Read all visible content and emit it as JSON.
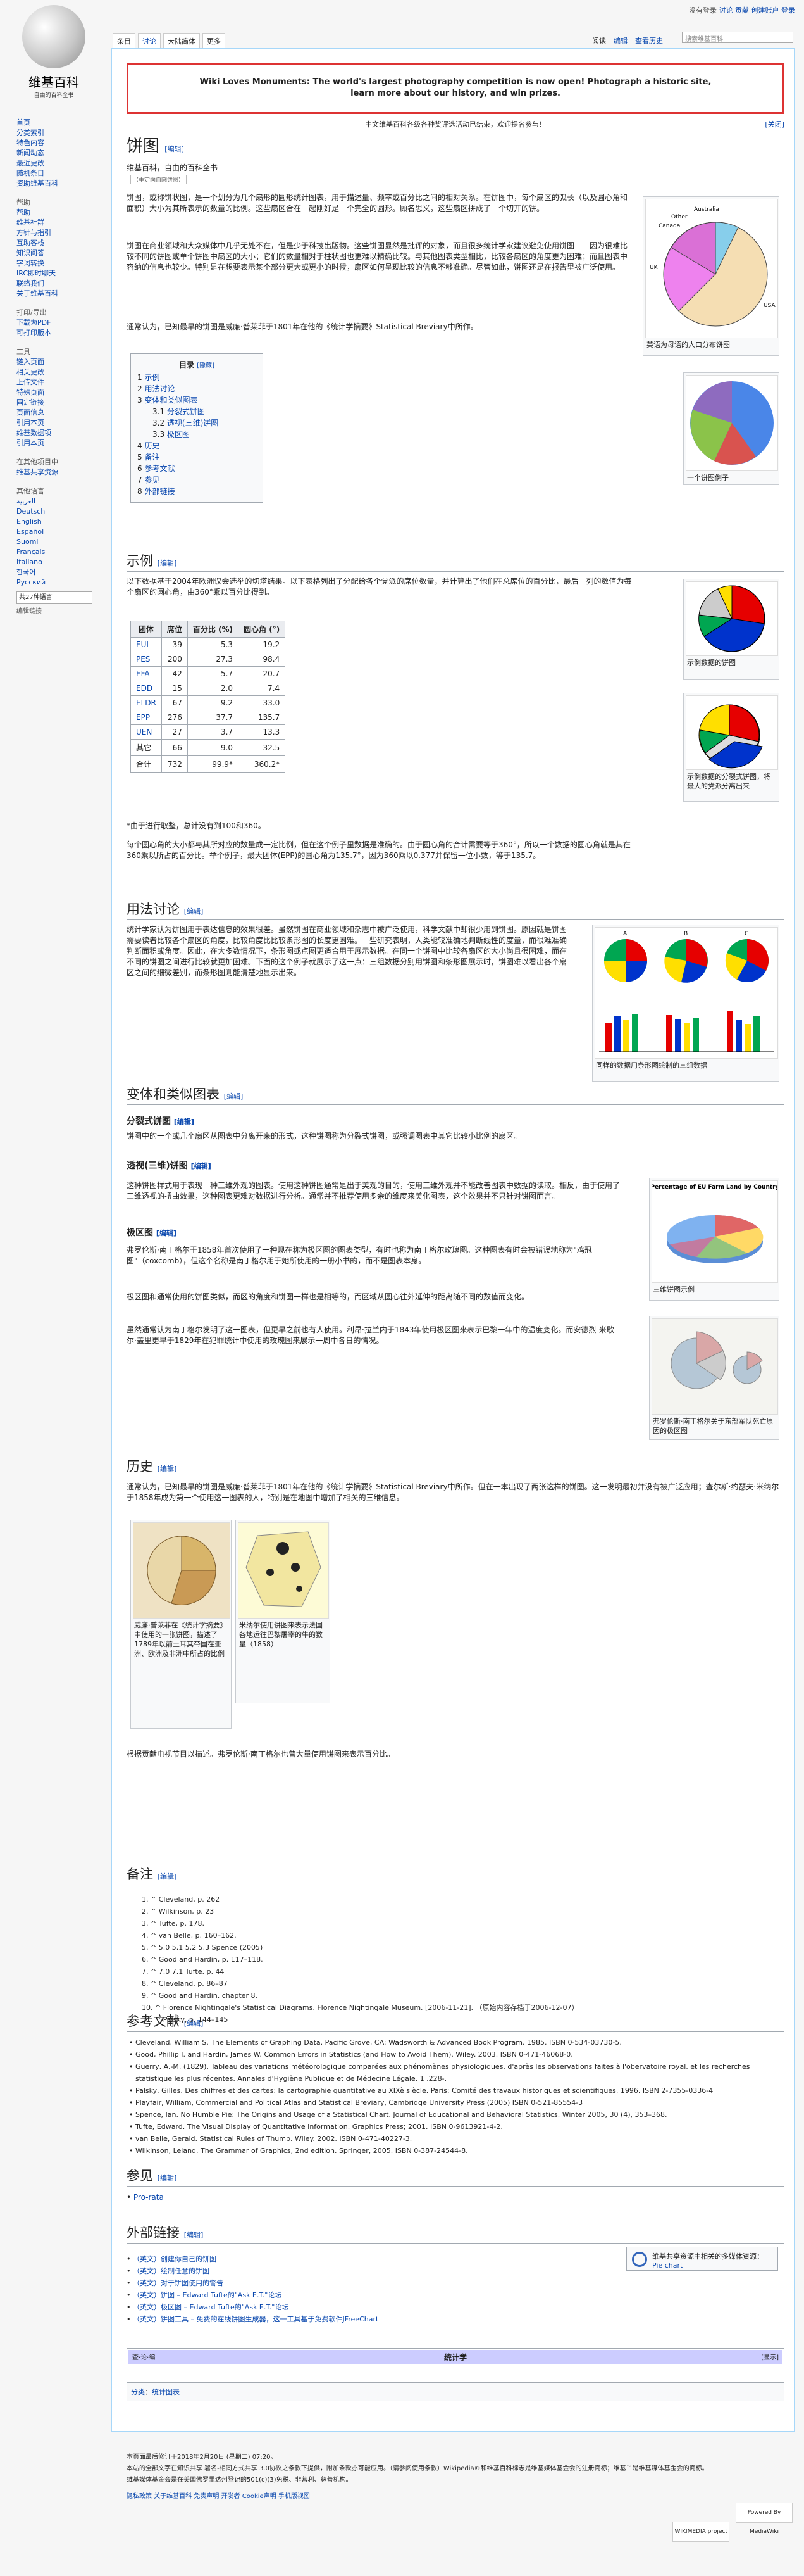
{
  "logo": {
    "name": "维基百科",
    "tagline": "自由的百科全书"
  },
  "personal_tools": [
    "没有登录",
    "讨论",
    "贡献",
    "创建账户",
    "登录"
  ],
  "tabs_left": [
    "条目",
    "讨论",
    "大陆简体",
    "更多"
  ],
  "tabs_right": [
    "阅读",
    "编辑",
    "查看历史"
  ],
  "search_placeholder": "搜索维基百科",
  "sidebar": {
    "nav": [
      "首页",
      "分类索引",
      "特色内容",
      "新闻动态",
      "最近更改",
      "随机条目",
      "资助维基百科"
    ],
    "help_title": "帮助",
    "help": [
      "帮助",
      "维基社群",
      "方针与指引",
      "互助客栈",
      "知识问答",
      "字词转换",
      "IRC即时聊天",
      "联络我们",
      "关于维基百科"
    ],
    "tools_title": "工具",
    "tools": [
      "链入页面",
      "相关更改",
      "上传文件",
      "特殊页面",
      "固定链接",
      "页面信息",
      "引用本页",
      "维基数据项",
      "引用本页"
    ],
    "print_title": "打印/导出",
    "print": [
      "下载为PDF",
      "可打印版本"
    ],
    "other_title": "在其他项目中",
    "other": [
      "维基共享资源"
    ],
    "lang_title": "其他语言",
    "langs": [
      "العربية",
      "Deutsch",
      "English",
      "Español",
      "Suomi",
      "Français",
      "Italiano",
      "한국어",
      "Русский"
    ],
    "lang_search": "共27种语言",
    "lang_edit": "编辑链接"
  },
  "banner": {
    "line1": "Wiki Loves Monuments: The world's largest photography competition is now open! Photograph a historic site,",
    "line2": "learn more about our history, and win prizes."
  },
  "notice": {
    "text": "中文维基百科各级各种奖评选活动已结束，欢迎提名参与！",
    "close": "[关闭]"
  },
  "page": {
    "title": "饼图",
    "edit": "[编辑]",
    "from": "维基百科，自由的百科全书",
    "redirect": "（重定向自圆饼图）",
    "intro": [
      "饼图，或称饼状图，是一个划分为几个扇形的圆形统计图表，用于描述量、频率或百分比之间的相对关系。在饼图中，每个扇区的弧长（以及圆心角和面积）大小为其所表示的数量的比例。这些扇区合在一起刚好是一个完全的圆形。顾名思义，这些扇区拼成了一个切开的饼。",
      "饼图在商业领域和大众媒体中几乎无处不在，但是少于科技出版物。这些饼图显然是批评的对象，而且很多统计学家建议避免使用饼图——因为很难比较不同的饼图或单个饼图中扇区的大小；它们的数量相对于柱状图也更难以精确比较。与其他图表类型相比，比较各扇区的角度更为困难；而且图表中容纳的信息也较少。特别是在想要表示某个部分更大或更小的时候，扇区如何呈现比较的信息不够准确。尽管如此，饼图还是在报告里被广泛使用。",
      "通常认为，已知最早的饼图是威廉·普莱菲于1801年在他的《统计学摘要》Statistical Breviary中所作。"
    ],
    "toc": {
      "title": "目录",
      "hide": "[隐藏]",
      "items": [
        {
          "n": "1",
          "t": "示例",
          "sub": false
        },
        {
          "n": "2",
          "t": "用法讨论",
          "sub": false
        },
        {
          "n": "3",
          "t": "变体和类似图表",
          "sub": false
        },
        {
          "n": "3.1",
          "t": "分裂式饼图",
          "sub": true
        },
        {
          "n": "3.2",
          "t": "透视(三维)饼图",
          "sub": true
        },
        {
          "n": "3.3",
          "t": "极区图",
          "sub": true
        },
        {
          "n": "4",
          "t": "历史",
          "sub": false
        },
        {
          "n": "5",
          "t": "备注",
          "sub": false
        },
        {
          "n": "6",
          "t": "参考文献",
          "sub": false
        },
        {
          "n": "7",
          "t": "参见",
          "sub": false
        },
        {
          "n": "8",
          "t": "外部链接",
          "sub": false
        }
      ]
    }
  },
  "thumbs": {
    "t1": "英语为母语的人口分布饼图",
    "t2": "一个饼图例子",
    "t3": "示例数据的饼图",
    "t4": "示例数据的分裂式饼图，将最大的党派分离出来",
    "t5": "同样的数据用条形图绘制的三组数据",
    "t6": "三维饼图示例",
    "t7": "弗罗伦斯·南丁格尔关于东部军队死亡原因的极区图",
    "t6_title": "Percentage of EU Farm Land by Country",
    "pie1_labels": [
      "Australia",
      "Other",
      "Canada",
      "UK",
      "USA"
    ],
    "bar_labels": [
      "A",
      "B",
      "C"
    ]
  },
  "sections": {
    "s1": {
      "title": "示例",
      "edit": "[编辑]",
      "intro": "以下数据基于2004年欧洲议会选举的切塔结果。以下表格列出了分配给各个党派的席位数量，并计算出了他们在总席位的百分比，最后一列的数值为每个扇区的圆心角，由360°乘以百分比得到。",
      "note": "*由于进行取整，总计没有到100和360。",
      "after": "每个圆心角的大小都与其所对应的数量成一定比例，但在这个例子里数据是准确的。由于圆心角的合计需要等于360°，所以一个数据的圆心角就是其在360乘以所占的百分比。举个例子，最大团体(EPP)的圆心角为135.7°，因为360乘以0.377并保留一位小数，等于135.7。"
    },
    "s2": {
      "title": "用法讨论",
      "edit": "[编辑]",
      "text": "统计学家认为饼图用于表达信息的效果很差。虽然饼图在商业领域和杂志中被广泛使用，科学文献中却很少用到饼图。原因就是饼图需要读者比较各个扇区的角度，比较角度比比较条形图的长度更困难。一些研究表明，人类能较准确地判断线性的度量，而很难准确判断面积或角度。因此，在大多数情况下，条形图或点图更适合用于展示数据。在同一个饼图中比较各扇区的大小尚且很困难，而在不同的饼图之间进行比较就更加困难。下面的这个例子就展示了这一点：三组数据分别用饼图和条形图展示时，饼图难以看出各个扇区之间的细微差别，而条形图则能清楚地显示出来。"
    },
    "s3": {
      "title": "变体和类似图表",
      "edit": "[编辑]"
    },
    "s31": {
      "title": "分裂式饼图",
      "edit": "[编辑]",
      "text": "饼图中的一个或几个扇区从图表中分离开来的形式，这种饼图称为分裂式饼图，或强调图表中其它比较小比例的扇区。"
    },
    "s32": {
      "title": "透视(三维)饼图",
      "edit": "[编辑]",
      "text": "这种饼图样式用于表现一种三维外观的图表。使用这种饼图通常是出于美观的目的，使用三维外观并不能改善图表中数据的读取。相反，由于使用了三维透视的扭曲效果，这种图表更难对数据进行分析。通常并不推荐使用多余的维度来美化图表，这个效果并不只针对饼图而言。"
    },
    "s33": {
      "title": "极区图",
      "edit": "[编辑]",
      "text1": "弗罗伦斯·南丁格尔于1858年首次使用了一种现在称为极区图的图表类型，有时也称为南丁格尔玫瑰图。这种图表有时会被错误地称为\"鸡冠图\"（coxcomb），但这个名称是南丁格尔用于她所使用的一册小书的，而不是图表本身。",
      "text2": "极区图和通常使用的饼图类似，而区的角度和饼图一样也是相等的，而区域从圆心往外延伸的距离随不同的数值而变化。",
      "text3": "虽然通常认为南丁格尔发明了这一图表，但更早之前也有人使用。利昂·拉兰内于1843年使用极区图来表示巴黎一年中的温度变化。而安德烈-米歇尔·盖里更早于1829年在犯罪统计中使用的玫瑰图来展示一周中各日的情况。"
    },
    "s4": {
      "title": "历史",
      "edit": "[编辑]",
      "text": "通常认为，已知最早的饼图是威廉·普莱菲于1801年在他的《统计学摘要》Statistical Breviary中所作。但在一本出现了两张这样的饼图。这一发明最初并没有被广泛应用；查尔斯·约瑟夫·米纳尔于1858年成为第一个使用这一图表的人，特别是在地图中增加了相关的三维信息。",
      "cap1": "威廉·普莱菲在《统计学摘要》中使用的一张饼图，描述了1789年以前土耳其帝国在亚洲、欧洲及非洲中所占的比例",
      "cap2": "米纳尔使用饼图来表示法国各地运往巴黎屠宰的牛的数量（1858）",
      "after": "根据贡献电视节目以描述。弗罗伦斯·南丁格尔也曾大量使用饼图来表示百分比。"
    },
    "s5": {
      "title": "备注",
      "edit": "[编辑]"
    },
    "s6": {
      "title": "参考文献",
      "edit": "[编辑]"
    },
    "s7": {
      "title": "参见",
      "edit": "[编辑]",
      "items": [
        "Pro-rata"
      ]
    },
    "s8": {
      "title": "外部链接",
      "edit": "[编辑]"
    }
  },
  "table": {
    "headers": [
      "团体",
      "席位",
      "百分比 (%)",
      "圆心角 (°)"
    ],
    "rows": [
      [
        "EUL",
        "39",
        "5.3",
        "19.2"
      ],
      [
        "PES",
        "200",
        "27.3",
        "98.4"
      ],
      [
        "EFA",
        "42",
        "5.7",
        "20.7"
      ],
      [
        "EDD",
        "15",
        "2.0",
        "7.4"
      ],
      [
        "ELDR",
        "67",
        "9.2",
        "33.0"
      ],
      [
        "EPP",
        "276",
        "37.7",
        "135.7"
      ],
      [
        "UEN",
        "27",
        "3.7",
        "13.3"
      ],
      [
        "其它",
        "66",
        "9.0",
        "32.5"
      ],
      [
        "合计",
        "732",
        "99.9*",
        "360.2*"
      ]
    ]
  },
  "notes": [
    "^ Cleveland, p. 262",
    "^ Wilkinson, p. 23",
    "^ Tufte, p. 178.",
    "^ van Belle, p. 160–162.",
    "^ 5.0 5.1 5.2 5.3 Spence (2005)",
    "^ Good and Hardin, p. 117–118.",
    "^ 7.0 7.1 Tufte, p. 44",
    "^ Cleveland, p. 86–87",
    "^ Good and Hardin, chapter 8.",
    "^ Florence Nightingale's Statistical Diagrams. Florence Nightingale Museum. [2006-11-21]. （原始内容存档于2006-12-07）",
    "^ Palsky, p. 144–145"
  ],
  "bibliography": [
    "Cleveland, William S. The Elements of Graphing Data. Pacific Grove, CA: Wadsworth & Advanced Book Program. 1985. ISBN 0-534-03730-5.",
    "Good, Phillip I. and Hardin, James W. Common Errors in Statistics (and How to Avoid Them). Wiley. 2003. ISBN 0-471-46068-0.",
    "Guerry, A.-M. (1829). Tableau des variations météorologique comparées aux phénomènes physiologiques, d'après les observations faites à l'obervatoire royal, et les recherches statistique les plus récentes. Annales d'Hygiène Publique et de Médecine Légale, 1 ,228-.",
    "Palsky, Gilles. Des chiffres et des cartes: la cartographie quantitative au XIXè siècle. Paris: Comité des travaux historiques et scientifiques, 1996. ISBN 2-7355-0336-4",
    "Playfair, William, Commercial and Political Atlas and Statistical Breviary, Cambridge University Press (2005) ISBN 0-521-85554-3",
    "Spence, Ian. No Humble Pie: The Origins and Usage of a Statistical Chart. Journal of Educational and Behavioral Statistics. Winter 2005, 30 (4), 353–368.",
    "Tufte, Edward. The Visual Display of Quantitative Information. Graphics Press; 2001. ISBN 0-9613921-4-2.",
    "van Belle, Gerald. Statistical Rules of Thumb. Wiley. 2002. ISBN 0-471-40227-3.",
    "Wilkinson, Leland. The Grammar of Graphics, 2nd edition. Springer, 2005. ISBN 0-387-24544-8."
  ],
  "external_links": [
    "（英文）创建你自己的饼图",
    "（英文）绘制任意的饼图",
    "（英文）对于饼图使用的警告",
    "（英文）饼图 – Edward Tufte的\"Ask E.T.\"论坛",
    "（英文）极区图 – Edward Tufte的\"Ask E.T.\"论坛",
    "（英文）饼图工具 – 免费的在线饼图生成器，这一工具基于免费软件JFreeChart"
  ],
  "commons": {
    "text": "维基共享资源中相关的多媒体资源：",
    "link": "Pie chart"
  },
  "navbox": {
    "left": "查·论·编",
    "title": "统计学",
    "right": "[显示]"
  },
  "categories": {
    "label": "分类",
    "items": [
      "统计图表"
    ]
  },
  "footer": {
    "modified": "本页面最后修订于2018年2月20日 (星期二) 07:20。",
    "license": "本站的全部文字在知识共享 署名-相同方式共享 3.0协议之条款下提供，附加条款亦可能应用。（请参阅使用条款）Wikipedia®和维基百科标志是维基媒体基金会的注册商标；维基™是维基媒体基金会的商标。",
    "org": "维基媒体基金会是在美国佛罗里达州登记的501(c)(3)免税、非营利、慈善机构。",
    "links": [
      "隐私政策",
      "关于维基百科",
      "免责声明",
      "开发者",
      "Cookie声明",
      "手机版视图"
    ],
    "logo1": "WIKIMEDIA project",
    "logo2": "Powered By MediaWiki"
  }
}
